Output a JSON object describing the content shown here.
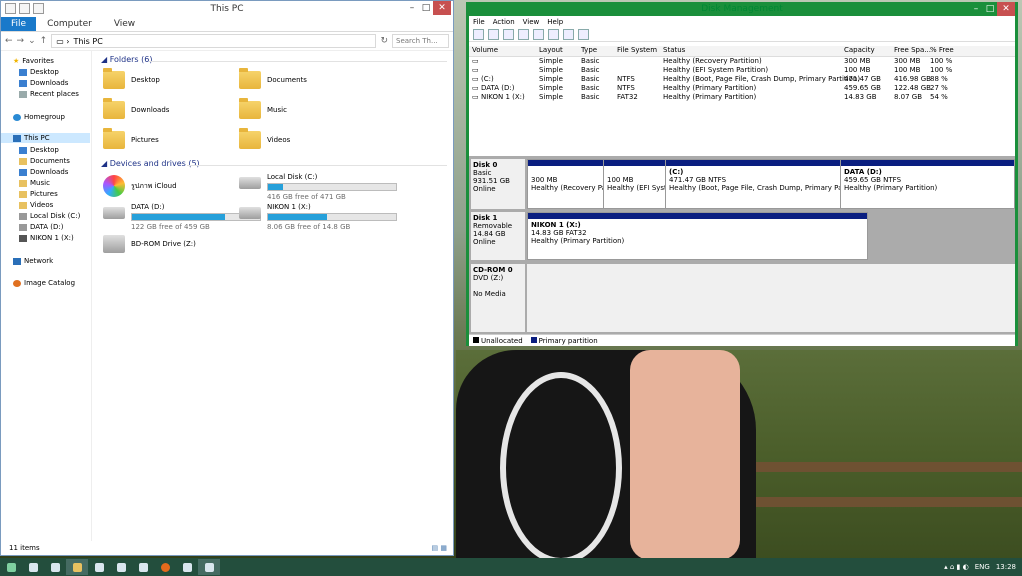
{
  "explorer": {
    "title": "This PC",
    "tabs": [
      "File",
      "Computer",
      "View"
    ],
    "address": "This PC",
    "search_placeholder": "Search Th...",
    "nav": {
      "favorites": "Favorites",
      "desktop": "Desktop",
      "downloads": "Downloads",
      "recent": "Recent places",
      "homegroup": "Homegroup",
      "thispc": "This PC",
      "pc_desktop": "Desktop",
      "pc_documents": "Documents",
      "pc_downloads": "Downloads",
      "pc_music": "Music",
      "pc_pictures": "Pictures",
      "pc_videos": "Videos",
      "pc_c": "Local Disk (C:)",
      "pc_d": "DATA (D:)",
      "pc_x": "NIKON 1 (X:)",
      "network": "Network",
      "catalog": "Image Catalog"
    },
    "folders_header": "Folders (6)",
    "folders": [
      "Desktop",
      "Documents",
      "Downloads",
      "Music",
      "Pictures",
      "Videos"
    ],
    "devices_header": "Devices and drives (5)",
    "icloud": "รูปภาพ iCloud",
    "drive_c": {
      "name": "Local Disk (C:)",
      "free": "416 GB free of 471 GB",
      "used_fraction": 0.12
    },
    "drive_d": {
      "name": "DATA (D:)",
      "free": "122 GB free of 459 GB",
      "used_fraction": 0.73
    },
    "drive_x": {
      "name": "NIKON 1 (X:)",
      "free": "8.06 GB free of 14.8 GB",
      "used_fraction": 0.46
    },
    "bd": "BD-ROM Drive (Z:)",
    "status": "11 items"
  },
  "dm": {
    "title": "Disk Management",
    "menu": [
      "File",
      "Action",
      "View",
      "Help"
    ],
    "columns": [
      "Volume",
      "Layout",
      "Type",
      "File System",
      "Status",
      "Capacity",
      "Free Spa...",
      "% Free"
    ],
    "volumes": [
      [
        "",
        "Simple",
        "Basic",
        "",
        "Healthy (Recovery Partition)",
        "300 MB",
        "300 MB",
        "100 %"
      ],
      [
        "",
        "Simple",
        "Basic",
        "",
        "Healthy (EFI System Partition)",
        "100 MB",
        "100 MB",
        "100 %"
      ],
      [
        "(C:)",
        "Simple",
        "Basic",
        "NTFS",
        "Healthy (Boot, Page File, Crash Dump, Primary Partition)",
        "471.47 GB",
        "416.98 GB",
        "88 %"
      ],
      [
        "DATA (D:)",
        "Simple",
        "Basic",
        "NTFS",
        "Healthy (Primary Partition)",
        "459.65 GB",
        "122.48 GB",
        "27 %"
      ],
      [
        "NIKON 1 (X:)",
        "Simple",
        "Basic",
        "FAT32",
        "Healthy (Primary Partition)",
        "14.83 GB",
        "8.07 GB",
        "54 %"
      ]
    ],
    "disk0": {
      "name": "Disk 0",
      "type": "Basic",
      "size": "931.51 GB",
      "state": "Online",
      "parts": [
        {
          "title": "",
          "size": "300 MB",
          "status": "Healthy (Recovery Partit"
        },
        {
          "title": "",
          "size": "100 MB",
          "status": "Healthy (EFI System"
        },
        {
          "title": "(C:)",
          "size": "471.47 GB NTFS",
          "status": "Healthy (Boot, Page File, Crash Dump, Primary Partition)"
        },
        {
          "title": "DATA (D:)",
          "size": "459.65 GB NTFS",
          "status": "Healthy (Primary Partition)"
        }
      ]
    },
    "disk1": {
      "name": "Disk 1",
      "type": "Removable",
      "size": "14.84 GB",
      "state": "Online",
      "parts": [
        {
          "title": "NIKON 1 (X:)",
          "size": "14.83 GB FAT32",
          "status": "Healthy (Primary Partition)"
        }
      ]
    },
    "cdrom": {
      "name": "CD-ROM 0",
      "type": "DVD (Z:)",
      "state": "No Media"
    },
    "legend": [
      "Unallocated",
      "Primary partition"
    ]
  },
  "taskbar": {
    "lang": "ENG",
    "time": "13:28"
  }
}
